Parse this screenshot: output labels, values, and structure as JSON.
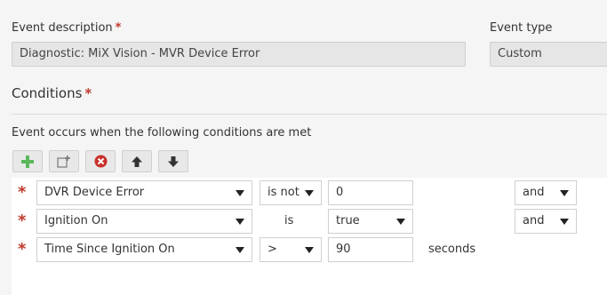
{
  "form": {
    "event_description_label": "Event description",
    "event_description_value": "Diagnostic: MiX Vision - MVR Device Error",
    "event_type_label": "Event type",
    "event_type_value": "Custom",
    "required_mark": "*"
  },
  "conditions": {
    "title": "Conditions",
    "intro": "Event occurs when the following conditions are met",
    "toolbar": [
      {
        "icon": "add-icon",
        "color": "#5cb85c"
      },
      {
        "icon": "add-group-icon",
        "color": "#777777"
      },
      {
        "icon": "remove-icon",
        "color": "#c9302c"
      },
      {
        "icon": "move-up-icon",
        "color": "#333333"
      },
      {
        "icon": "move-down-icon",
        "color": "#333333"
      }
    ],
    "rows": [
      {
        "field": "DVR Device Error",
        "operator": "is not",
        "operator_is_select": true,
        "value": "0",
        "value_is_select": false,
        "unit": "",
        "connector": "and"
      },
      {
        "field": "Ignition On",
        "operator": "is",
        "operator_is_select": false,
        "value": "true",
        "value_is_select": true,
        "unit": "",
        "connector": "and"
      },
      {
        "field": "Time Since Ignition On",
        "operator": ">",
        "operator_is_select": true,
        "value": "90",
        "value_is_select": false,
        "unit": "seconds",
        "connector": ""
      }
    ]
  }
}
